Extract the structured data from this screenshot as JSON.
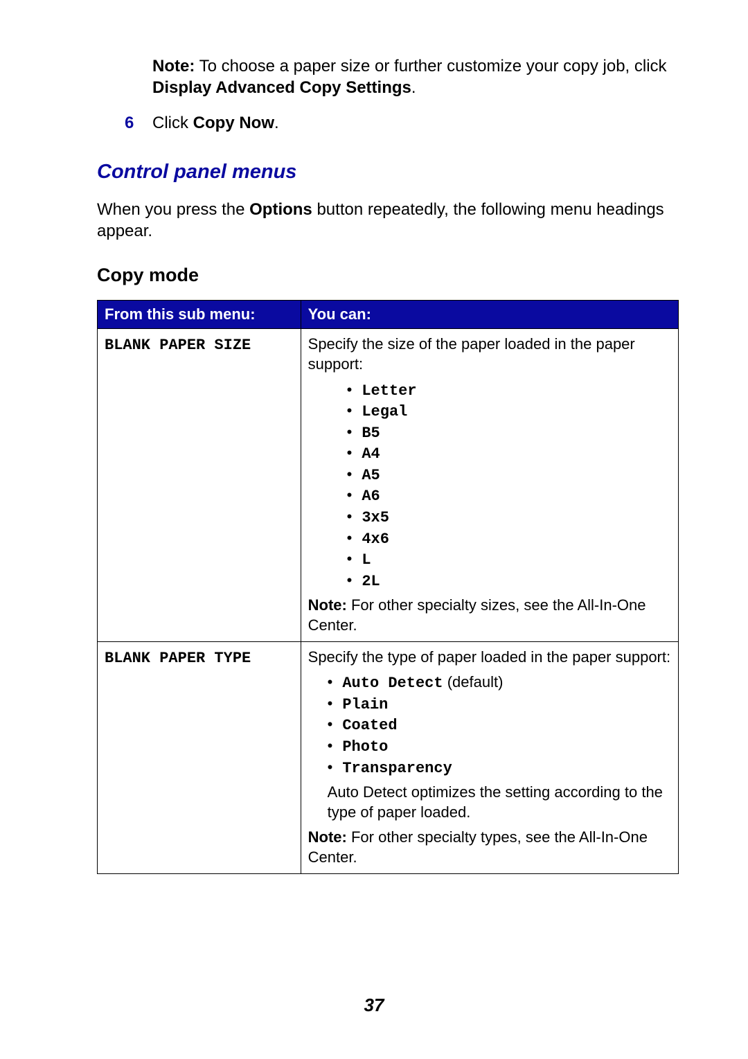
{
  "note_block": {
    "prefix": "Note:",
    "text_before": " To choose a paper size or further customize your copy job, click ",
    "bold_link": "Display Advanced Copy Settings",
    "text_after": "."
  },
  "step6": {
    "num": "6",
    "text_before": "Click ",
    "bold_link": "Copy Now",
    "text_after": "."
  },
  "section_heading": "Control panel menus",
  "section_para": {
    "before": "When you press the ",
    "bold": "Options",
    "after": " button repeatedly, the following menu headings appear."
  },
  "subsection_heading": "Copy mode",
  "table": {
    "head": [
      "From this sub menu:",
      "You can:"
    ],
    "rows": [
      {
        "menu": "BLANK PAPER SIZE",
        "desc_intro": "Specify the size of the paper loaded in the paper support:",
        "options": [
          "Letter",
          "Legal",
          "B5",
          "A4",
          "A5",
          "A6",
          "3x5",
          "4x6",
          "L",
          "2L"
        ],
        "note_prefix": "Note:",
        "note_text": " For other specialty sizes, see the All-In-One Center."
      },
      {
        "menu": "BLANK PAPER TYPE",
        "desc_intro": "Specify the type of paper loaded in the paper support:",
        "options_with_suffix": [
          {
            "name": "Auto Detect",
            "suffix": " (default)"
          },
          {
            "name": "Plain",
            "suffix": ""
          },
          {
            "name": "Coated",
            "suffix": ""
          },
          {
            "name": "Photo",
            "suffix": ""
          },
          {
            "name": "Transparency",
            "suffix": ""
          }
        ],
        "extra_text": "Auto Detect optimizes the setting according to the type of paper loaded.",
        "note_prefix": "Note:",
        "note_text": " For other specialty types, see the All-In-One Center."
      }
    ]
  },
  "page_number": "37"
}
